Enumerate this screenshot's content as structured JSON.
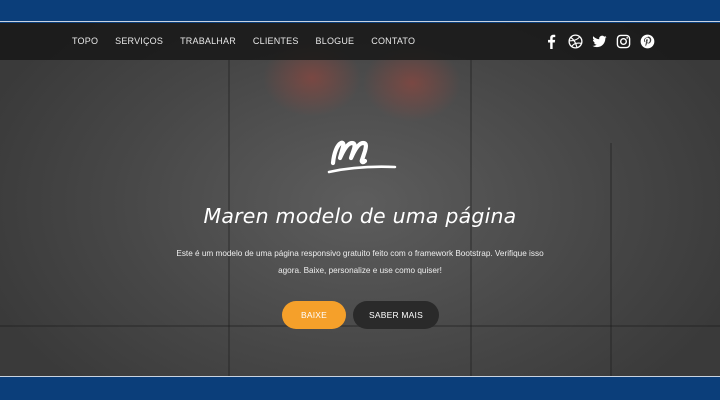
{
  "navbar": {
    "links": [
      "TOPO",
      "SERVIÇOS",
      "TRABALHAR",
      "CLIENTES",
      "BLOGUE",
      "CONTATO"
    ],
    "social_icons": [
      "facebook-icon",
      "dribbble-icon",
      "twitter-icon",
      "instagram-icon",
      "pinterest-icon"
    ]
  },
  "hero": {
    "logo_icon": "maren-logo",
    "title": "Maren modelo de uma página",
    "description_line1": "Este é um modelo de uma página responsivo gratuito feito com o framework Bootstrap. Verifique isso",
    "description_line2": "agora. Baixe, personalize e use como quiser!",
    "primary_button": "BAIXE",
    "secondary_button": "SABER MAIS"
  },
  "colors": {
    "frame": "#0b3e7a",
    "navbar": "#161616",
    "accent": "#f5a02a",
    "secondary_button": "#2a2a2a"
  }
}
